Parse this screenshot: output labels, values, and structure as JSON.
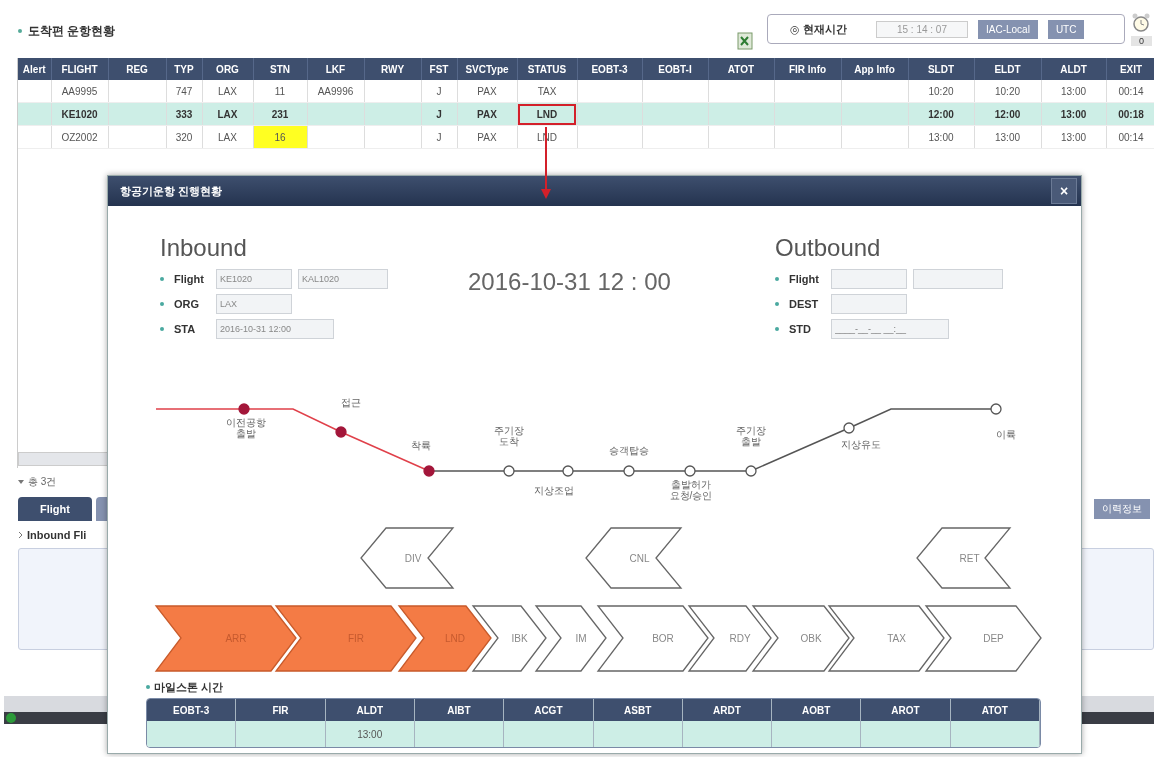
{
  "page_title": "도착편 운항현황",
  "clock": {
    "label": "◎ 현재시간",
    "time": "15 : 14 : 07",
    "buttons": [
      "IAC-Local",
      "UTC"
    ],
    "alarm_count": "0"
  },
  "flights_table": {
    "columns": [
      "Alert",
      "FLIGHT",
      "REG",
      "TYP",
      "ORG",
      "STN",
      "LKF",
      "RWY",
      "FST",
      "SVCType",
      "STATUS",
      "EOBT-3",
      "EOBT-I",
      "ATOT",
      "FIR Info",
      "App Info",
      "SLDT",
      "ELDT",
      "ALDT",
      "EXIT"
    ],
    "rows": [
      {
        "selected": false,
        "stn_highlight": false,
        "cells": [
          null,
          "AA9995",
          null,
          "747",
          "LAX",
          "11",
          "AA9996",
          null,
          "J",
          "PAX",
          "TAX",
          null,
          null,
          null,
          null,
          null,
          "10:20",
          "10:20",
          "13:00",
          "00:14"
        ]
      },
      {
        "selected": true,
        "stn_highlight": false,
        "cells": [
          null,
          "KE1020",
          null,
          "333",
          "LAX",
          "231",
          null,
          null,
          "J",
          "PAX",
          "LND",
          null,
          null,
          null,
          null,
          null,
          "12:00",
          "12:00",
          "13:00",
          "00:18"
        ]
      },
      {
        "selected": false,
        "stn_highlight": true,
        "cells": [
          null,
          "OZ2002",
          null,
          "320",
          "LAX",
          "16",
          null,
          null,
          "J",
          "PAX",
          "LND",
          null,
          null,
          null,
          null,
          null,
          "13:00",
          "13:00",
          "13:00",
          "00:14"
        ]
      }
    ]
  },
  "lower_panel": {
    "count_label": "총 3건",
    "tabs": [
      {
        "label": "Flight",
        "selected": true
      },
      {
        "selected": false
      }
    ],
    "subheading": "Inbound Fli",
    "history_button": "이력정보"
  },
  "dialog": {
    "title": "항공기운항 진행현황",
    "close": "×",
    "inbound": {
      "heading": "Inbound",
      "fields": [
        {
          "label": "Flight",
          "values": [
            "KE1020",
            "KAL1020"
          ]
        },
        {
          "label": "ORG",
          "values": [
            "LAX"
          ]
        },
        {
          "label": "STA",
          "values": [
            "2016-10-31 12:00"
          ]
        }
      ]
    },
    "datetime": "2016-10-31 12 : 00",
    "outbound": {
      "heading": "Outbound",
      "fields": [
        {
          "label": "Flight"
        },
        {
          "label": "DEST"
        },
        {
          "label": "STD",
          "placeholder": "____-__-__ __:__"
        }
      ]
    },
    "timeline": [
      {
        "label": "이전공항\n출발",
        "passed": true
      },
      {
        "label": "접근",
        "passed": true
      },
      {
        "label": "착륙",
        "passed": true
      },
      {
        "label": "주기장\n도착",
        "passed": false
      },
      {
        "label": "지상조업",
        "passed": false
      },
      {
        "label": "승객탑승",
        "passed": false
      },
      {
        "label": "출발허가\n요청/승인",
        "passed": false
      },
      {
        "label": "주기장\n출발",
        "passed": false
      },
      {
        "label": "지상유도",
        "passed": false
      },
      {
        "label": "이륙",
        "passed": false
      }
    ],
    "back_stages": [
      "DIV",
      "CNL",
      "RET"
    ],
    "stages": [
      {
        "label": "ARR",
        "done": true
      },
      {
        "label": "FIR",
        "done": true
      },
      {
        "label": "LND",
        "done": true
      },
      {
        "label": "IBK",
        "done": false
      },
      {
        "label": "IM",
        "done": false
      },
      {
        "label": "BOR",
        "done": false
      },
      {
        "label": "RDY",
        "done": false
      },
      {
        "label": "OBK",
        "done": false
      },
      {
        "label": "TAX",
        "done": false
      },
      {
        "label": "DEP",
        "done": false
      }
    ],
    "milestones": {
      "title": "마일스톤 시간",
      "columns": [
        {
          "label": "EOBT-3"
        },
        {
          "label": "FIR"
        },
        {
          "label": "ALDT",
          "value": "13:00"
        },
        {
          "label": "AIBT"
        },
        {
          "label": "ACGT"
        },
        {
          "label": "ASBT"
        },
        {
          "label": "ARDT"
        },
        {
          "label": "AOBT"
        },
        {
          "label": "AROT"
        },
        {
          "label": "ATOT"
        }
      ]
    }
  }
}
